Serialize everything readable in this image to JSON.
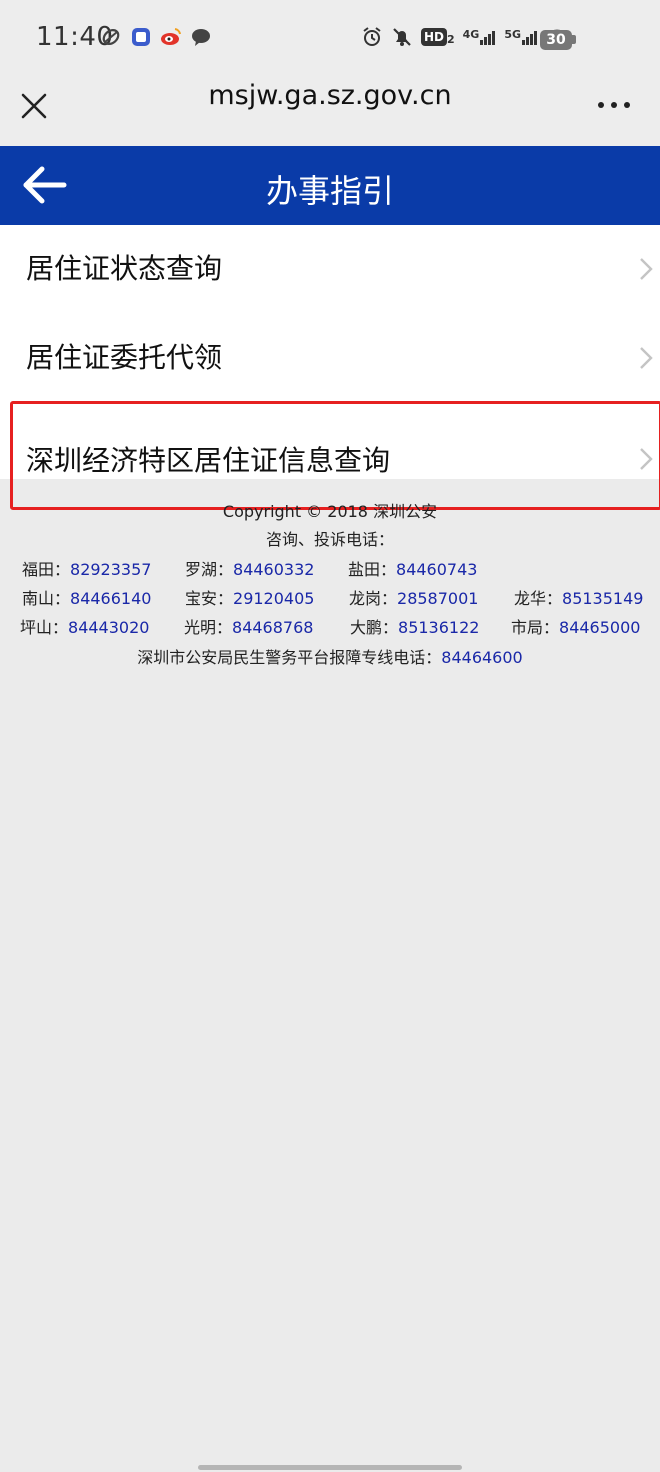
{
  "status_bar": {
    "time": "11:40",
    "left_icons": [
      "sync-icon",
      "tieba-icon",
      "weibo-icon",
      "chat-bubble-icon"
    ],
    "hd_badge": "HD",
    "hd_sub": "2",
    "net_4g": "4G",
    "net_5g": "5G",
    "battery": "30"
  },
  "browser": {
    "url": "msjw.ga.sz.gov.cn"
  },
  "header": {
    "title": "办事指引"
  },
  "menu": {
    "items": [
      {
        "label": "居住证状态查询"
      },
      {
        "label": "居住证委托代领"
      },
      {
        "label": "深圳经济特区居住证信息查询"
      }
    ]
  },
  "footer": {
    "copyright": "Copyright © 2018 深圳公安",
    "consult": "咨询、投诉电话：",
    "phones": [
      {
        "name": "福田：",
        "number": "82923357"
      },
      {
        "name": "罗湖：",
        "number": "84460332"
      },
      {
        "name": "盐田：",
        "number": "84460743"
      },
      {
        "name": "南山：",
        "number": "84466140"
      },
      {
        "name": "宝安：",
        "number": "29120405"
      },
      {
        "name": "龙岗：",
        "number": "28587001"
      },
      {
        "name": "龙华：",
        "number": "85135149"
      },
      {
        "name": "坪山：",
        "number": "84443020"
      },
      {
        "name": "光明：",
        "number": "84468768"
      },
      {
        "name": "大鹏：",
        "number": "85136122"
      },
      {
        "name": "市局：",
        "number": "84465000"
      }
    ],
    "hotline_label": "深圳市公安局民生警务平台报障专线电话：",
    "hotline_number": "84464600"
  },
  "colors": {
    "header_bg": "#0a3ba8",
    "highlight_border": "#e62020",
    "phone_number": "#1a28a8"
  }
}
